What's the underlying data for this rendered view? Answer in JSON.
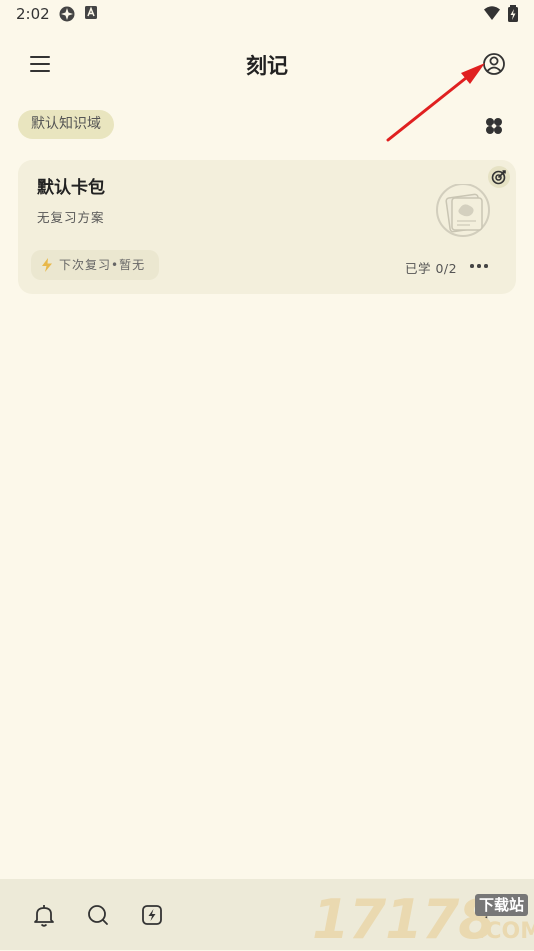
{
  "status_bar": {
    "time": "2:02"
  },
  "app_bar": {
    "title": "刻记"
  },
  "knowledge_domain": {
    "label": "默认知识域"
  },
  "deck": {
    "title": "默认卡包",
    "subtitle": "无复习方案",
    "next_review": "下次复习•暂无",
    "progress": "已学 0/2"
  },
  "watermark": {
    "number": "17178",
    "site": "下载站",
    "suffix": ".COM"
  },
  "colors": {
    "background": "#fcf8ea",
    "card": "#f3efdc",
    "chip": "#e9e5bf",
    "bottom_bar": "#edead8",
    "bolt": "#e8b84a",
    "annotation_arrow": "#e02020"
  }
}
